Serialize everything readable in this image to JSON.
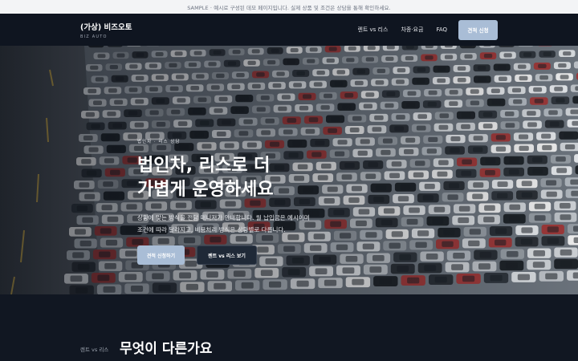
{
  "notice": "SAMPLE · 예시로 구성된 데모 페이지입니다. 실제 상품 및 조건은 상담을 통해 확인하세요.",
  "nav": {
    "brand_name": "(가상) 비즈오토",
    "brand_sub": "BIZ AUTO",
    "links": [
      "렌트 vs 리스",
      "차종·요금",
      "FAQ"
    ],
    "cta": "견적 신청"
  },
  "hero": {
    "eyebrow": "법인차 · 리스 상담",
    "headline_lines": [
      "법인차, 리스로 더",
      "가볍게 운영하세요"
    ],
    "desc_lines": [
      "상황에 맞는 방식을 전담 매니저가 안내합니다. 월 납입금은 예시이며",
      "조건에 따라 달라지고, 비용처리 방식은 상황별로 다릅니다."
    ],
    "primary_cta": "견적 신청하기",
    "secondary_cta": "렌트 vs 리스 보기"
  },
  "section": {
    "eyebrow": "렌트 vs 리스",
    "title": "무엇이 다른가요"
  }
}
